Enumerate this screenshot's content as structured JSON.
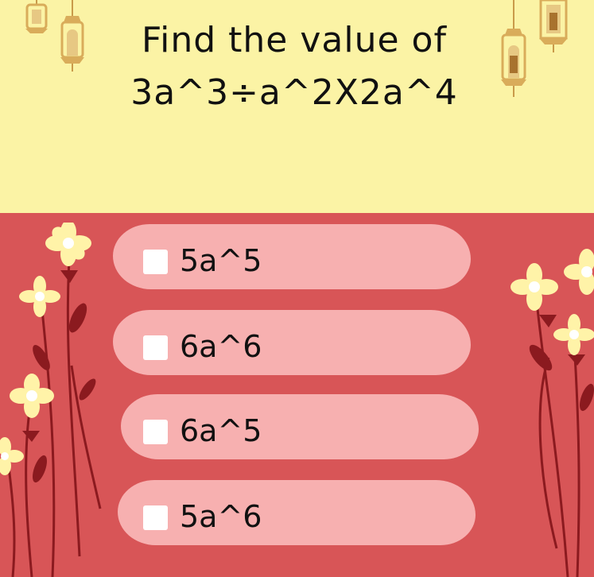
{
  "question": {
    "line1": "Find the value of",
    "line2": "3a^3÷a^2X2a^4"
  },
  "options": [
    {
      "label": "5a^5",
      "checked": false
    },
    {
      "label": "6a^6",
      "checked": false
    },
    {
      "label": "6a^5",
      "checked": false
    },
    {
      "label": "5a^6",
      "checked": false
    }
  ],
  "colors": {
    "top_bg": "#fbf3a5",
    "bottom_bg": "#d85557",
    "option_bg": "#f7b0b0",
    "lantern": "#d9ac5a",
    "stem": "#8b1a1f",
    "flower": "#fff3a8"
  }
}
